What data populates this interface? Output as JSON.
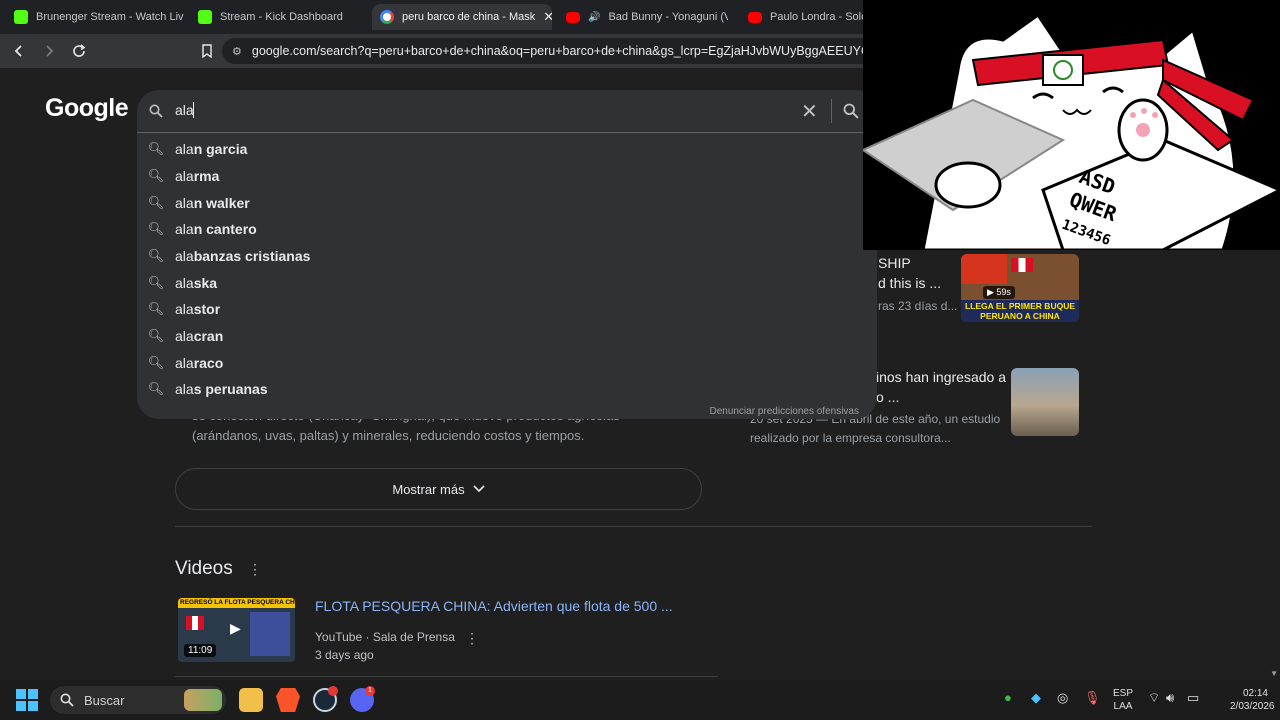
{
  "tabs": [
    {
      "label": "Brunenger Stream - Watch Live o",
      "favicon": "kick"
    },
    {
      "label": "Stream - Kick Dashboard",
      "favicon": "kick"
    },
    {
      "label": "peru barco de china - Mask",
      "favicon": "google",
      "active": true
    },
    {
      "label": "Bad Bunny - Yonaguni (Vide",
      "favicon": "youtube"
    },
    {
      "label": "Paulo Londra - Solo P",
      "favicon": "youtube"
    }
  ],
  "toolbar": {
    "url": "google.com/search?q=peru+barco+de+china&oq=peru+barco+de+china&gs_lcrp=EgZjaHJvbWUyBggAEEUYOTIGCA"
  },
  "search": {
    "logo": "Google",
    "query": "ala",
    "report_link": "Denunciar predicciones ofensivas",
    "suggestions": [
      {
        "prefix": "ala",
        "rest": "n garcia",
        "bold_prefix": false
      },
      {
        "prefix": "ala",
        "rest": "rma"
      },
      {
        "prefix": "ala",
        "rest": "n walker"
      },
      {
        "prefix": "ala",
        "rest": "n cantero"
      },
      {
        "prefix": "ala",
        "rest": "banzas cristianas"
      },
      {
        "prefix": "ala",
        "rest": "ska"
      },
      {
        "prefix": "ala",
        "rest": "stor"
      },
      {
        "prefix": "ala",
        "rest": "cran"
      },
      {
        "prefix": "ala",
        "rest": "raco"
      },
      {
        "prefix": "ala",
        "rest": "s peruanas"
      }
    ]
  },
  "results": {
    "snippet_line1": "se conecten directo (Chancay- Shanghai), que mueve productos agrícolas",
    "snippet_line2": "(arándanos, uvas, paltas) y minerales, reduciendo costos y tiempos.",
    "show_more": "Mostrar más",
    "side1_title_a": "SHIP",
    "side1_title_b": "d this is ...",
    "side1_sub": "ras 23 días d...",
    "side1_thumb_badge": "59s",
    "side1_thumb_caption": "LLEGA EL PRIMER BUQUE PERUANO A CHINA",
    "side2_title_a": "inos han ingresado a",
    "side2_title_b": "o ...",
    "side2_sub_a": "20 set 2025 — En abril de este año, un estudio",
    "side2_sub_b": "realizado por la empresa consultora..."
  },
  "videos": {
    "heading": "Videos",
    "items": [
      {
        "title": "FLOTA PESQUERA CHINA: Advierten que flota de 500 ...",
        "source": "YouTube · Sala de Prensa",
        "date": "3 days ago",
        "duration": "11:09",
        "thumb_banner": "REGRESÓ LA FLOTA PESQUERA CHINA"
      }
    ]
  },
  "overlay": {
    "keys_row1": "ASD",
    "keys_row2": "QWER",
    "keys_row3": "123456"
  },
  "taskbar": {
    "search_placeholder": "Buscar",
    "lang_line1": "ESP",
    "lang_line2": "LAA",
    "time": "02:14",
    "date": "2/03/2026",
    "discord_badge": "1"
  },
  "colors": {
    "page_bg": "#1f1f1f",
    "link": "#8ab4f8",
    "kick_green": "#53fc18",
    "youtube_red": "#ff0000"
  }
}
